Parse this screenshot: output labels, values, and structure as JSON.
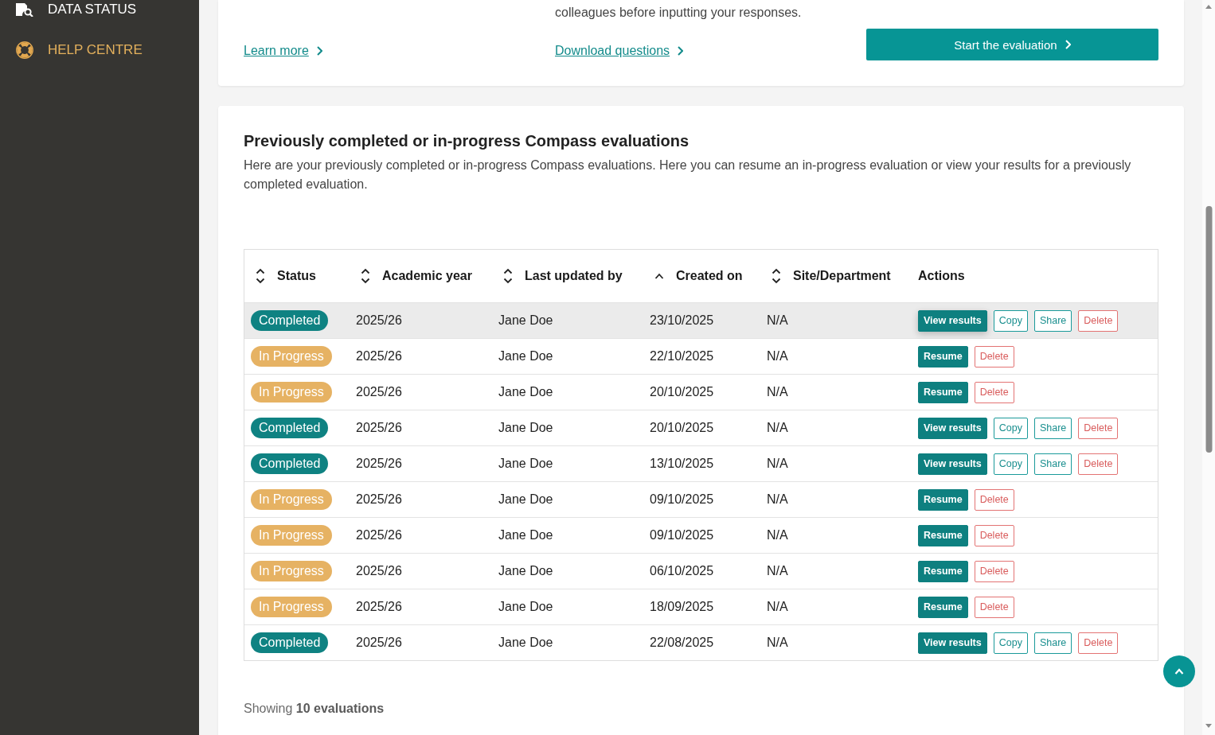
{
  "sidebar": {
    "items": [
      {
        "label": "DATA STATUS",
        "hovered": false
      },
      {
        "label": "HELP CENTRE",
        "hovered": true
      }
    ]
  },
  "intro": {
    "columns": [
      {
        "link": "Learn more"
      },
      {
        "text": "colleagues before inputting your responses.",
        "link": "Download questions"
      }
    ],
    "start_button": "Start the evaluation"
  },
  "evaluations": {
    "title": "Previously completed or in-progress Compass evaluations",
    "description": "Here are your previously completed or in-progress Compass evaluations. Here you can resume an in-progress evaluation or view your results for a previously completed evaluation.",
    "table": {
      "columns": [
        {
          "label": "Status",
          "kind": "sortable"
        },
        {
          "label": "Academic year",
          "kind": "sortable"
        },
        {
          "label": "Last updated by",
          "kind": "sortable"
        },
        {
          "label": "Created on",
          "kind": "ascending"
        },
        {
          "label": "Site/Department",
          "kind": "sortable"
        },
        {
          "label": "Actions",
          "kind": "plain"
        }
      ],
      "rows": [
        {
          "hovered": true,
          "status": {
            "label": "Completed",
            "kind": "completed"
          },
          "academic_year": "2025/26",
          "last_updated_by": "Jane Doe",
          "created_on": "23/10/2025",
          "site_department": "N/A",
          "actions": [
            {
              "label": "View results",
              "kind": "view"
            },
            {
              "label": "Copy",
              "kind": "copy"
            },
            {
              "label": "Share",
              "kind": "share"
            },
            {
              "label": "Delete",
              "kind": "delete"
            }
          ]
        },
        {
          "hovered": false,
          "status": {
            "label": "In Progress",
            "kind": "in_progress"
          },
          "academic_year": "2025/26",
          "last_updated_by": "Jane Doe",
          "created_on": "22/10/2025",
          "site_department": "N/A",
          "actions": [
            {
              "label": "Resume",
              "kind": "resume"
            },
            {
              "label": "Delete",
              "kind": "delete"
            }
          ]
        },
        {
          "hovered": false,
          "status": {
            "label": "In Progress",
            "kind": "in_progress"
          },
          "academic_year": "2025/26",
          "last_updated_by": "Jane Doe",
          "created_on": "20/10/2025",
          "site_department": "N/A",
          "actions": [
            {
              "label": "Resume",
              "kind": "resume"
            },
            {
              "label": "Delete",
              "kind": "delete"
            }
          ]
        },
        {
          "hovered": false,
          "status": {
            "label": "Completed",
            "kind": "completed"
          },
          "academic_year": "2025/26",
          "last_updated_by": "Jane Doe",
          "created_on": "20/10/2025",
          "site_department": "N/A",
          "actions": [
            {
              "label": "View results",
              "kind": "view"
            },
            {
              "label": "Copy",
              "kind": "copy"
            },
            {
              "label": "Share",
              "kind": "share"
            },
            {
              "label": "Delete",
              "kind": "delete"
            }
          ]
        },
        {
          "hovered": false,
          "status": {
            "label": "Completed",
            "kind": "completed"
          },
          "academic_year": "2025/26",
          "last_updated_by": "Jane Doe",
          "created_on": "13/10/2025",
          "site_department": "N/A",
          "actions": [
            {
              "label": "View results",
              "kind": "view"
            },
            {
              "label": "Copy",
              "kind": "copy"
            },
            {
              "label": "Share",
              "kind": "share"
            },
            {
              "label": "Delete",
              "kind": "delete"
            }
          ]
        },
        {
          "hovered": false,
          "status": {
            "label": "In Progress",
            "kind": "in_progress"
          },
          "academic_year": "2025/26",
          "last_updated_by": "Jane Doe",
          "created_on": "09/10/2025",
          "site_department": "N/A",
          "actions": [
            {
              "label": "Resume",
              "kind": "resume"
            },
            {
              "label": "Delete",
              "kind": "delete"
            }
          ]
        },
        {
          "hovered": false,
          "status": {
            "label": "In Progress",
            "kind": "in_progress"
          },
          "academic_year": "2025/26",
          "last_updated_by": "Jane Doe",
          "created_on": "09/10/2025",
          "site_department": "N/A",
          "actions": [
            {
              "label": "Resume",
              "kind": "resume"
            },
            {
              "label": "Delete",
              "kind": "delete"
            }
          ]
        },
        {
          "hovered": false,
          "status": {
            "label": "In Progress",
            "kind": "in_progress"
          },
          "academic_year": "2025/26",
          "last_updated_by": "Jane Doe",
          "created_on": "06/10/2025",
          "site_department": "N/A",
          "actions": [
            {
              "label": "Resume",
              "kind": "resume"
            },
            {
              "label": "Delete",
              "kind": "delete"
            }
          ]
        },
        {
          "hovered": false,
          "status": {
            "label": "In Progress",
            "kind": "in_progress"
          },
          "academic_year": "2025/26",
          "last_updated_by": "Jane Doe",
          "created_on": "18/09/2025",
          "site_department": "N/A",
          "actions": [
            {
              "label": "Resume",
              "kind": "resume"
            },
            {
              "label": "Delete",
              "kind": "delete"
            }
          ]
        },
        {
          "hovered": false,
          "status": {
            "label": "Completed",
            "kind": "completed"
          },
          "academic_year": "2025/26",
          "last_updated_by": "Jane Doe",
          "created_on": "22/08/2025",
          "site_department": "N/A",
          "actions": [
            {
              "label": "View results",
              "kind": "view"
            },
            {
              "label": "Copy",
              "kind": "copy"
            },
            {
              "label": "Share",
              "kind": "share"
            },
            {
              "label": "Delete",
              "kind": "delete"
            }
          ]
        }
      ]
    },
    "footer": "Showing **10 evaluations**"
  }
}
